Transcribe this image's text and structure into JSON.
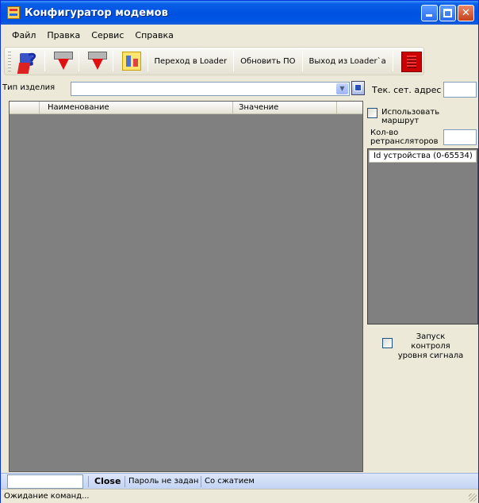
{
  "window": {
    "title": "Конфигуратор модемов"
  },
  "menu": {
    "items": [
      "Файл",
      "Правка",
      "Сервис",
      "Справка"
    ]
  },
  "toolbar": {
    "goto_loader": "Переход в Loader",
    "update_fw": "Обновить ПО",
    "exit_loader": "Выход из Loader`a"
  },
  "product": {
    "label": "Тип изделия",
    "value": ""
  },
  "grid": {
    "columns": [
      "Наименование",
      "Значение"
    ]
  },
  "right": {
    "addr_label": "Тек. сет. адрес",
    "addr_value": "",
    "use_route_label": "Использовать маршрут",
    "repeaters_label": "Кол-во ретрансляторов",
    "repeaters_value": "",
    "id_header": "Id устройства (0-65534)",
    "signal_label": "Запуск контроля уровня сигнала"
  },
  "bottom": {
    "close": "Close",
    "password": "Пароль не задан",
    "compression": "Со сжатием"
  },
  "status": {
    "text": "Ожидание команд..."
  }
}
